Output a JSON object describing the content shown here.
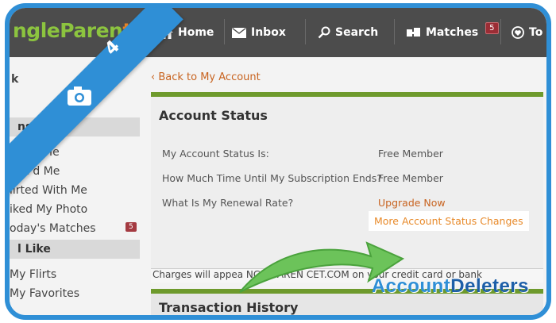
{
  "header": {
    "logo_main": "ngleParen",
    "logo_tail": "t",
    "nav": [
      {
        "label": "Home",
        "icon": "home-icon"
      },
      {
        "label": "Inbox",
        "icon": "envelope-icon"
      },
      {
        "label": "Search",
        "icon": "search-icon"
      },
      {
        "label": "Matches",
        "icon": "matches-icon",
        "badge": "5"
      },
      {
        "label": "To",
        "icon": "heart-icon"
      }
    ]
  },
  "sidebar": {
    "section_1_head": "ns",
    "items_1": [
      "ewed Me",
      "ave'd Me",
      "lirted With Me",
      "iked My Photo",
      "oday's Matches"
    ],
    "todays_matches_badge": "5",
    "section_2_head": "l Like",
    "items_2": [
      "My Flirts",
      "My Favorites"
    ]
  },
  "main": {
    "back_link": "Back to My Account",
    "status": {
      "title": "Account Status",
      "rows": [
        {
          "label": "My Account Status Is:",
          "value": "Free Member"
        },
        {
          "label": "How Much Time Until My Subscription Ends?",
          "value": "Free Member"
        },
        {
          "label": "What Is My Renewal Rate?",
          "value": "Upgrade Now"
        }
      ],
      "more_link": "More Account Status Changes"
    },
    "charges_text": "Charges will appea        NGLEPAREN        CET.COM on your credit card or bank",
    "transaction_title": "Transaction History"
  },
  "overlay": {
    "step_number": "4",
    "watermark_a": "Account",
    "watermark_b": "Deleters"
  },
  "colors": {
    "accent": "#2f8fd6",
    "link": "#c8631f",
    "green_bar": "#6e9a2c",
    "badge": "#9b2d35"
  }
}
